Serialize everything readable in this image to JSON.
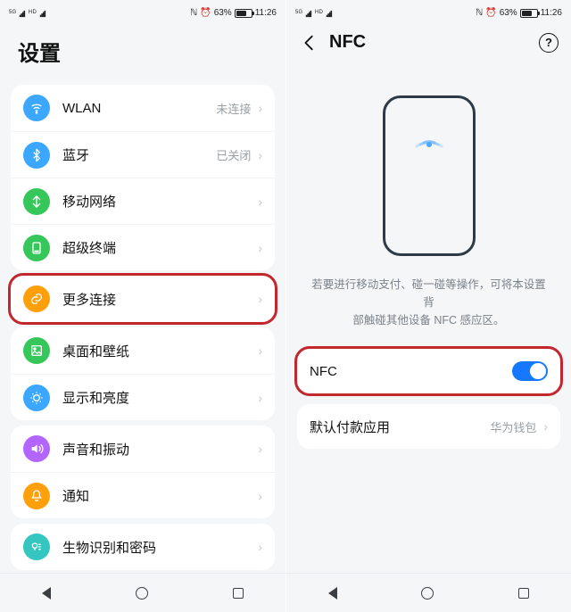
{
  "status": {
    "network_badge": "5G",
    "hd_badge": "HD",
    "nfc_glyph": "ℕ",
    "battery_pct": "63%",
    "time": "11:26",
    "alarm_glyph": "⏰"
  },
  "left": {
    "title": "设置",
    "groups": [
      {
        "items": [
          {
            "icon": "wifi-icon",
            "color": "#3ba7ff",
            "label": "WLAN",
            "value": "未连接"
          },
          {
            "icon": "bluetooth-icon",
            "color": "#3ba7ff",
            "label": "蓝牙",
            "value": "已关闭"
          },
          {
            "icon": "cellular-icon",
            "color": "#35c759",
            "label": "移动网络",
            "value": ""
          },
          {
            "icon": "device-icon",
            "color": "#35c759",
            "label": "超级终端",
            "value": ""
          }
        ]
      },
      {
        "highlight": true,
        "items": [
          {
            "icon": "link-icon",
            "color": "#ff9f0a",
            "label": "更多连接",
            "value": ""
          }
        ]
      },
      {
        "items": [
          {
            "icon": "wallpaper-icon",
            "color": "#35c759",
            "label": "桌面和壁纸",
            "value": ""
          },
          {
            "icon": "display-icon",
            "color": "#3ba7ff",
            "label": "显示和亮度",
            "value": ""
          }
        ]
      },
      {
        "items": [
          {
            "icon": "sound-icon",
            "color": "#b366ff",
            "label": "声音和振动",
            "value": ""
          },
          {
            "icon": "bell-icon",
            "color": "#ff9f0a",
            "label": "通知",
            "value": ""
          }
        ]
      },
      {
        "items": [
          {
            "icon": "fingerprint-icon",
            "color": "#35c6c1",
            "label": "生物识别和密码",
            "value": ""
          }
        ]
      }
    ]
  },
  "right": {
    "title": "NFC",
    "desc_line1": "若要进行移动支付、碰一碰等操作，可将本设置背",
    "desc_line2": "部触碰其他设备 NFC 感应区。",
    "rows": {
      "nfc_label": "NFC",
      "default_app_label": "默认付款应用",
      "default_app_value": "华为钱包"
    }
  }
}
